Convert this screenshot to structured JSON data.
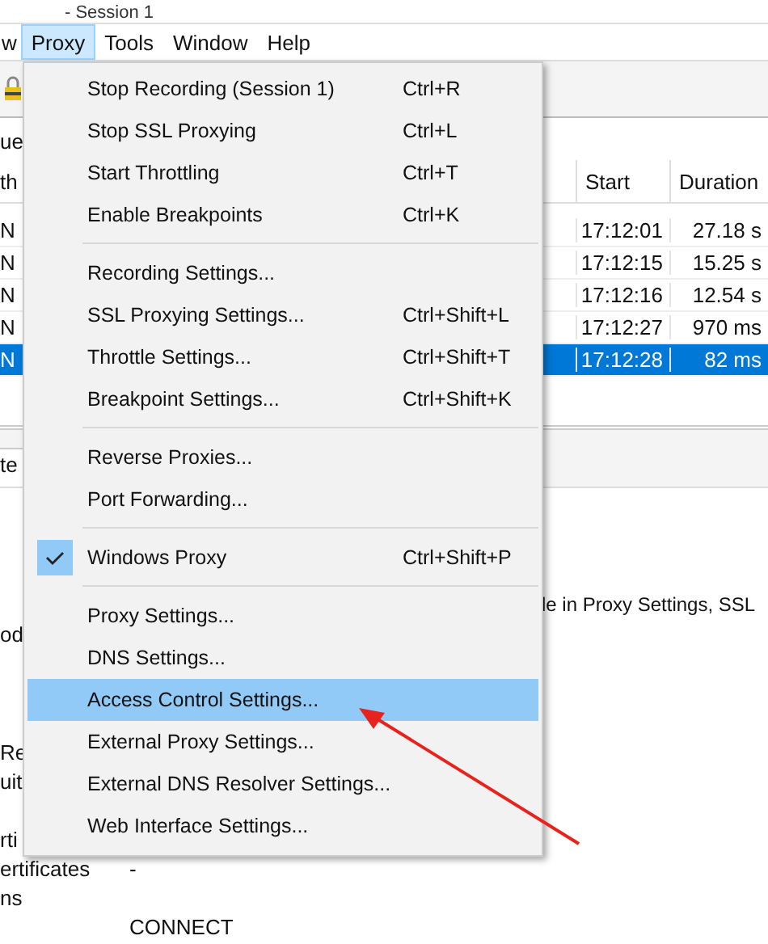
{
  "window": {
    "title": "- Session 1"
  },
  "menu_bar": [
    {
      "label": "w",
      "selected": false
    },
    {
      "label": "Proxy",
      "selected": true
    },
    {
      "label": "Tools",
      "selected": false
    },
    {
      "label": "Window",
      "selected": false
    },
    {
      "label": "Help",
      "selected": false
    }
  ],
  "session": {
    "label": "ue",
    "table": {
      "columns": [
        "th",
        "Start",
        "Duration"
      ],
      "rows": [
        {
          "cells": [
            "N",
            "17:12:01",
            "27.18 s"
          ],
          "selected": false
        },
        {
          "cells": [
            "N",
            "17:12:15",
            "15.25 s"
          ],
          "selected": false
        },
        {
          "cells": [
            "N",
            "17:12:16",
            "12.54 s"
          ],
          "selected": false
        },
        {
          "cells": [
            "N",
            "17:12:27",
            "970 ms"
          ],
          "selected": false
        },
        {
          "cells": [
            "N",
            "17:12:28",
            "82 ms"
          ],
          "selected": true
        }
      ]
    }
  },
  "detail": {
    "tab": "te",
    "sections": [
      {
        "lines": [
          {
            "kind": "tail",
            "value": "le in Proxy Settings, SSL"
          },
          {
            "kind": "row",
            "label": "od"
          }
        ]
      },
      {
        "lines": [
          {
            "kind": "row",
            "label": "Re"
          },
          {
            "kind": "row",
            "label": "uit"
          }
        ]
      },
      {
        "lines": [
          {
            "kind": "row",
            "label": "rti"
          },
          {
            "kind": "row",
            "label": "ertificates",
            "value": "-"
          },
          {
            "kind": "row",
            "label": "ns"
          },
          {
            "kind": "row",
            "value": "CONNECT"
          }
        ]
      }
    ]
  },
  "proxy_menu": {
    "items": [
      {
        "kind": "item",
        "label": "Stop Recording (Session 1)",
        "shortcut": "Ctrl+R",
        "checked": false,
        "selected": false
      },
      {
        "kind": "item",
        "label": "Stop SSL Proxying",
        "shortcut": "Ctrl+L",
        "checked": false,
        "selected": false
      },
      {
        "kind": "item",
        "label": "Start Throttling",
        "shortcut": "Ctrl+T",
        "checked": false,
        "selected": false
      },
      {
        "kind": "item",
        "label": "Enable Breakpoints",
        "shortcut": "Ctrl+K",
        "checked": false,
        "selected": false
      },
      {
        "kind": "separator"
      },
      {
        "kind": "item",
        "label": "Recording Settings...",
        "checked": false,
        "selected": false
      },
      {
        "kind": "item",
        "label": "SSL Proxying Settings...",
        "shortcut": "Ctrl+Shift+L",
        "checked": false,
        "selected": false
      },
      {
        "kind": "item",
        "label": "Throttle Settings...",
        "shortcut": "Ctrl+Shift+T",
        "checked": false,
        "selected": false
      },
      {
        "kind": "item",
        "label": "Breakpoint Settings...",
        "shortcut": "Ctrl+Shift+K",
        "checked": false,
        "selected": false
      },
      {
        "kind": "separator"
      },
      {
        "kind": "item",
        "label": "Reverse Proxies...",
        "checked": false,
        "selected": false
      },
      {
        "kind": "item",
        "label": "Port Forwarding...",
        "checked": false,
        "selected": false
      },
      {
        "kind": "separator"
      },
      {
        "kind": "item",
        "label": "Windows Proxy",
        "shortcut": "Ctrl+Shift+P",
        "checked": true,
        "selected": false
      },
      {
        "kind": "separator"
      },
      {
        "kind": "item",
        "label": "Proxy Settings...",
        "checked": false,
        "selected": false
      },
      {
        "kind": "item",
        "label": "DNS Settings...",
        "checked": false,
        "selected": false
      },
      {
        "kind": "item",
        "label": "Access Control Settings...",
        "checked": false,
        "selected": true
      },
      {
        "kind": "item",
        "label": "External Proxy Settings...",
        "checked": false,
        "selected": false
      },
      {
        "kind": "item",
        "label": "External DNS Resolver Settings...",
        "checked": false,
        "selected": false
      },
      {
        "kind": "item",
        "label": "Web Interface Settings...",
        "checked": false,
        "selected": false
      }
    ]
  }
}
